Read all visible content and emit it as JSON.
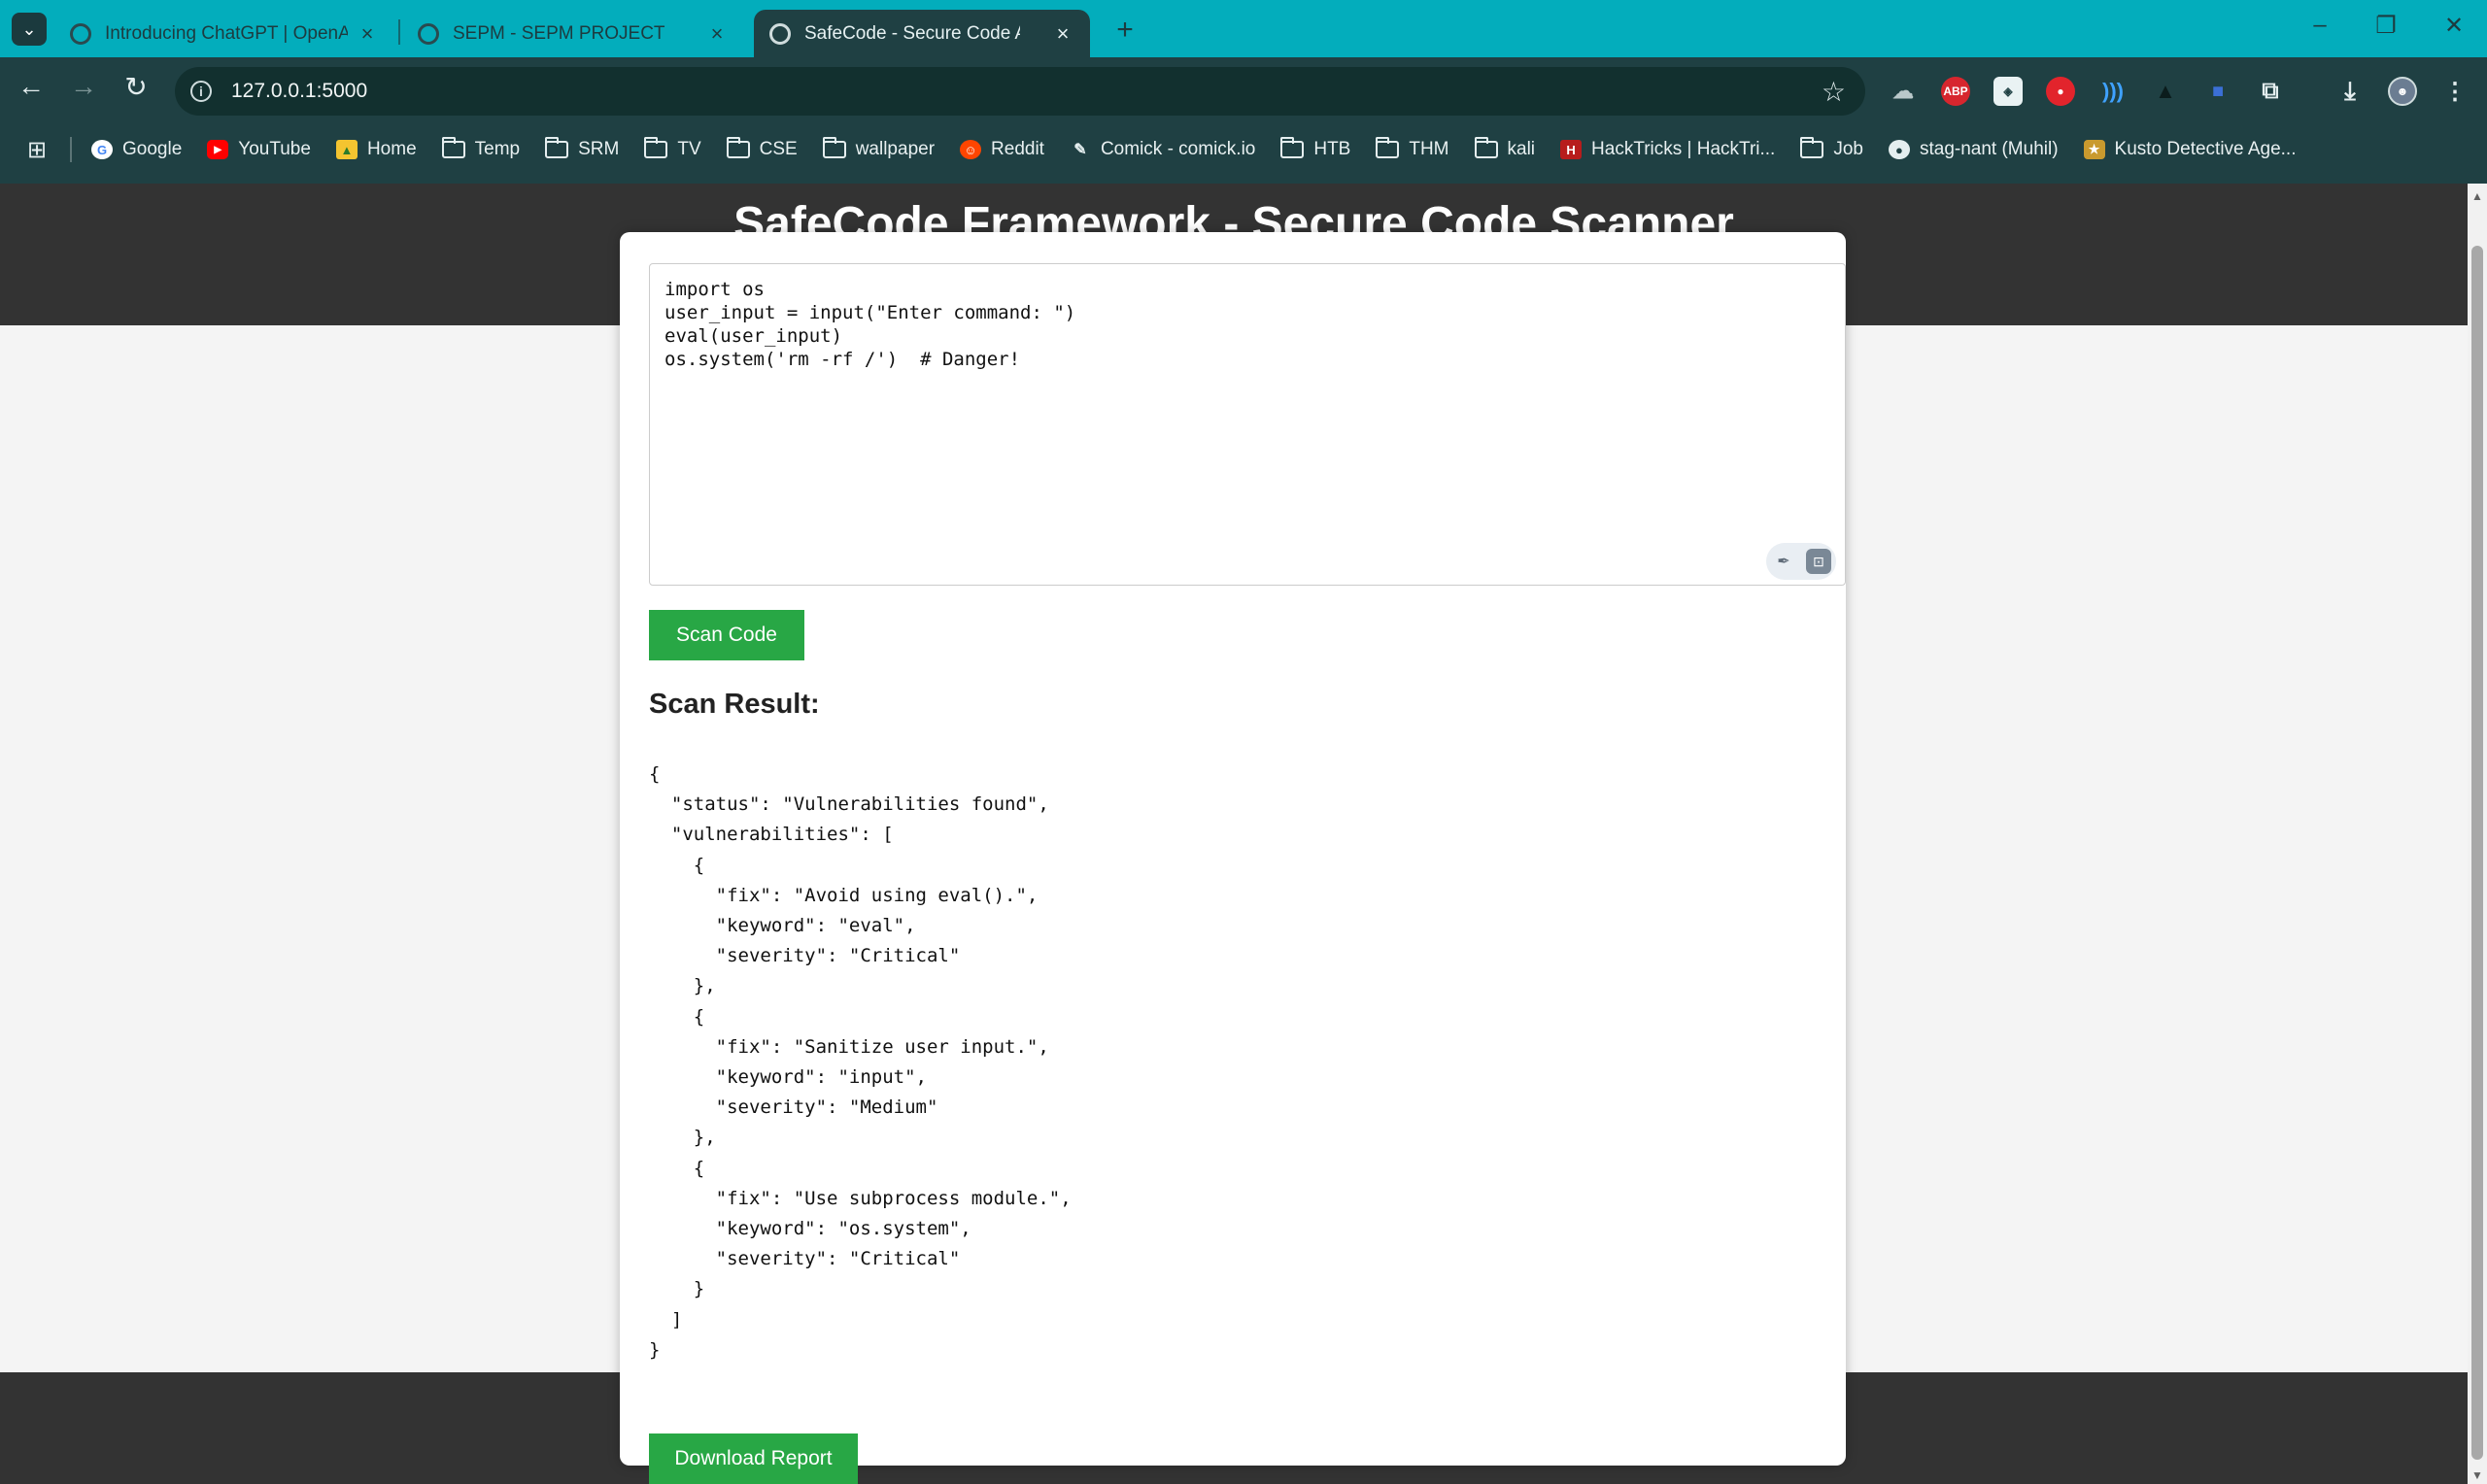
{
  "browser": {
    "tabs": [
      {
        "title": "Introducing ChatGPT | OpenAI",
        "active": false
      },
      {
        "title": "SEPM - SEPM PROJECT",
        "active": false
      },
      {
        "title": "SafeCode - Secure Code Analysis",
        "active": true
      }
    ],
    "url": "127.0.0.1:5000",
    "bookmarks": [
      {
        "label": "Google",
        "icon": "google-icon"
      },
      {
        "label": "YouTube",
        "icon": "youtube-icon"
      },
      {
        "label": "Home",
        "icon": "image-icon"
      },
      {
        "label": "Temp",
        "icon": "folder-icon"
      },
      {
        "label": "SRM",
        "icon": "folder-icon"
      },
      {
        "label": "TV",
        "icon": "folder-icon"
      },
      {
        "label": "CSE",
        "icon": "folder-icon"
      },
      {
        "label": "wallpaper",
        "icon": "folder-icon"
      },
      {
        "label": "Reddit",
        "icon": "reddit-icon"
      },
      {
        "label": "Comick - comick.io",
        "icon": "comick-icon"
      },
      {
        "label": "HTB",
        "icon": "folder-icon"
      },
      {
        "label": "THM",
        "icon": "folder-icon"
      },
      {
        "label": "kali",
        "icon": "folder-icon"
      },
      {
        "label": "HackTricks | HackTri...",
        "icon": "hacktricks-icon"
      },
      {
        "label": "Job",
        "icon": "folder-icon"
      },
      {
        "label": "stag-nant (Muhil)",
        "icon": "github-icon"
      },
      {
        "label": "Kusto Detective Age...",
        "icon": "kusto-icon"
      }
    ],
    "extensions": [
      {
        "name": "extension-cloud-icon",
        "label": ""
      },
      {
        "name": "adblock-plus-icon",
        "label": "ABP"
      },
      {
        "name": "shield-extension-icon",
        "label": ""
      },
      {
        "name": "red-extension-icon",
        "label": ""
      },
      {
        "name": "wave-extension-icon",
        "label": ""
      },
      {
        "name": "dark-extension-icon",
        "label": ""
      },
      {
        "name": "camera-extension-icon",
        "label": ""
      },
      {
        "name": "puzzle-icon",
        "label": ""
      },
      {
        "name": "download-icon",
        "label": ""
      },
      {
        "name": "profile-avatar-icon",
        "label": ""
      }
    ]
  },
  "page": {
    "title": "SafeCode Framework - Secure Code Scanner",
    "code_input": "import os\nuser_input = input(\"Enter command: \")\neval(user_input)\nos.system('rm -rf /')  # Danger!",
    "scan_button": "Scan Code",
    "result_heading": "Scan Result:",
    "result_json": "{\n  \"status\": \"Vulnerabilities found\",\n  \"vulnerabilities\": [\n    {\n      \"fix\": \"Avoid using eval().\",\n      \"keyword\": \"eval\",\n      \"severity\": \"Critical\"\n    },\n    {\n      \"fix\": \"Sanitize user input.\",\n      \"keyword\": \"input\",\n      \"severity\": \"Medium\"\n    },\n    {\n      \"fix\": \"Use subprocess module.\",\n      \"keyword\": \"os.system\",\n      \"severity\": \"Critical\"\n    }\n  ]\n}",
    "download_button": "Download Report"
  },
  "colors": {
    "tabbar": "#03adbc",
    "toolbar": "#1f4043",
    "header_bg": "#333333",
    "button_green": "#28a745"
  }
}
